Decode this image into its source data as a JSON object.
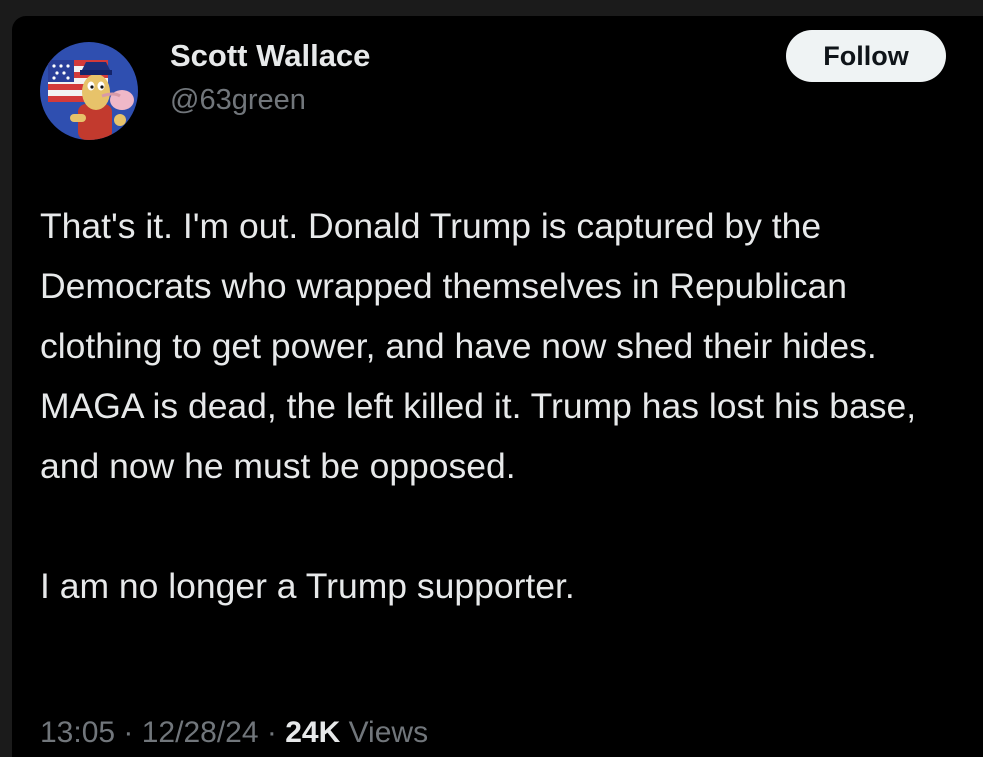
{
  "author": {
    "name": "Scott Wallace",
    "handle": "@63green",
    "avatar_icon": "cartoon-character-avatar-icon"
  },
  "follow_button": {
    "label": "Follow"
  },
  "tweet": {
    "paragraph_1": "That's it. I'm out. Donald Trump is captured by the Democrats who wrapped themselves in Republican clothing to get power, and have now shed their hides. MAGA is dead, the left killed it. Trump has lost his base, and now he must be opposed.",
    "paragraph_2": "I am no longer a Trump supporter."
  },
  "meta": {
    "time": "13:05",
    "separator": " · ",
    "date": "12/28/24",
    "views_count": "24K",
    "views_label": " Views"
  },
  "colors": {
    "background": "#000000",
    "text_primary": "#e7e9ea",
    "text_secondary": "#71767b",
    "button_bg": "#eff3f4",
    "button_text": "#0f1419"
  }
}
